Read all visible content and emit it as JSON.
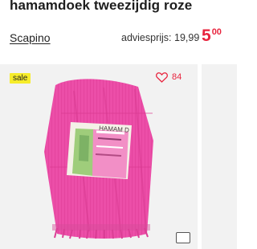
{
  "product": {
    "title": "hamamdoek tweezijdig roze",
    "brand": "Scapino",
    "advice_price": "adviesprijs: 19,99",
    "price": {
      "whole": "5",
      "cents": "00",
      "color": "#e8243e"
    }
  },
  "card": {
    "sale_label": "sale",
    "favorites_count": "84",
    "image_icon": "folded-pink-hammam-towel-image",
    "badge_color": "#f6ec2a"
  },
  "accent_colors": {
    "towel_pink": "#ec4ea8",
    "background_gray": "#f2f2f2"
  }
}
